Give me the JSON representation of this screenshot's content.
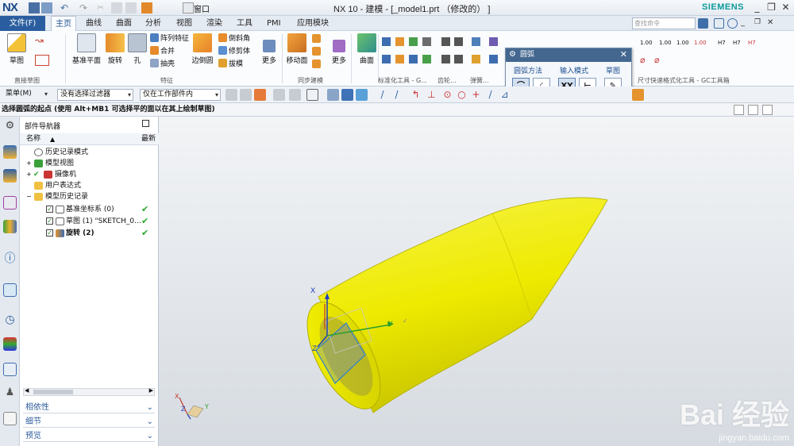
{
  "app": {
    "logo": "NX",
    "window_title": "NX 10 - 建模 - [_model1.prt （修改的） ]",
    "brand": "SIEMENS",
    "search_placeholder": "查找命令"
  },
  "quick_access": {
    "window_menu": "窗口"
  },
  "menu": {
    "file": "文件(F)",
    "tabs": [
      "主页",
      "曲线",
      "曲面",
      "分析",
      "视图",
      "渲染",
      "工具",
      "PMI",
      "应用模块"
    ],
    "active_tab": "主页"
  },
  "ribbon": {
    "sketch": {
      "label": "草图",
      "group": "直接草图"
    },
    "feature": {
      "datum_plane": "基准平面",
      "revolve": "旋转",
      "hole": "孔",
      "pattern": "阵列特征",
      "unite": "合并",
      "shell": "抽壳",
      "edge_blend": "边倒圆",
      "chamfer": "倒斜角",
      "trim_body": "修剪体",
      "draft": "拔模",
      "more": "更多",
      "group": "特征"
    },
    "sync": {
      "move_face": "移动面",
      "more": "更多",
      "group": "同步建模"
    },
    "surface": {
      "label": "曲面"
    },
    "groups": {
      "standard_tools": "标准化工具 - G...",
      "gear": "齿轮...",
      "spring": "弹簧...",
      "dim_tools": "尺寸快速格式化工具 - GC工具箱"
    }
  },
  "toolbar": {
    "menu": "菜单(M)",
    "filter": "没有选择过滤器",
    "scope": "仅在工作部件内"
  },
  "status": {
    "prompt": "选择圆弧的起点 (使用 Alt+MB1 可选择平的面以在其上绘制草图)"
  },
  "navigator": {
    "title": "部件导航器",
    "col_name": "名称",
    "col_latest": "最新",
    "nodes": [
      {
        "label": "历史记录模式"
      },
      {
        "label": "模型视图"
      },
      {
        "label": "摄像机"
      },
      {
        "label": "用户表达式"
      },
      {
        "label": "模型历史记录"
      },
      {
        "label": "基准坐标系 (0)"
      },
      {
        "label": "草图 (1) \"SKETCH_0..."
      },
      {
        "label": "旋转 (2)"
      }
    ],
    "panels": [
      "相依性",
      "细节",
      "预览"
    ]
  },
  "dialog": {
    "title": "圆弧",
    "arc_method": "圆弧方法",
    "input_mode": "输入模式",
    "sketch": "草图",
    "xy": "XY"
  },
  "viewport": {
    "triad_x": "X",
    "triad_y": "Y",
    "triad_z": "Z",
    "csys_x": "X",
    "csys_y": "Y",
    "csys_z": "Z"
  },
  "watermark": {
    "main": "Bai 经验",
    "url": "jingyan.baidu.com"
  },
  "colors": {
    "body": "#f2ee00",
    "accent": "#2a5d9f",
    "check": "#2aa52a"
  }
}
